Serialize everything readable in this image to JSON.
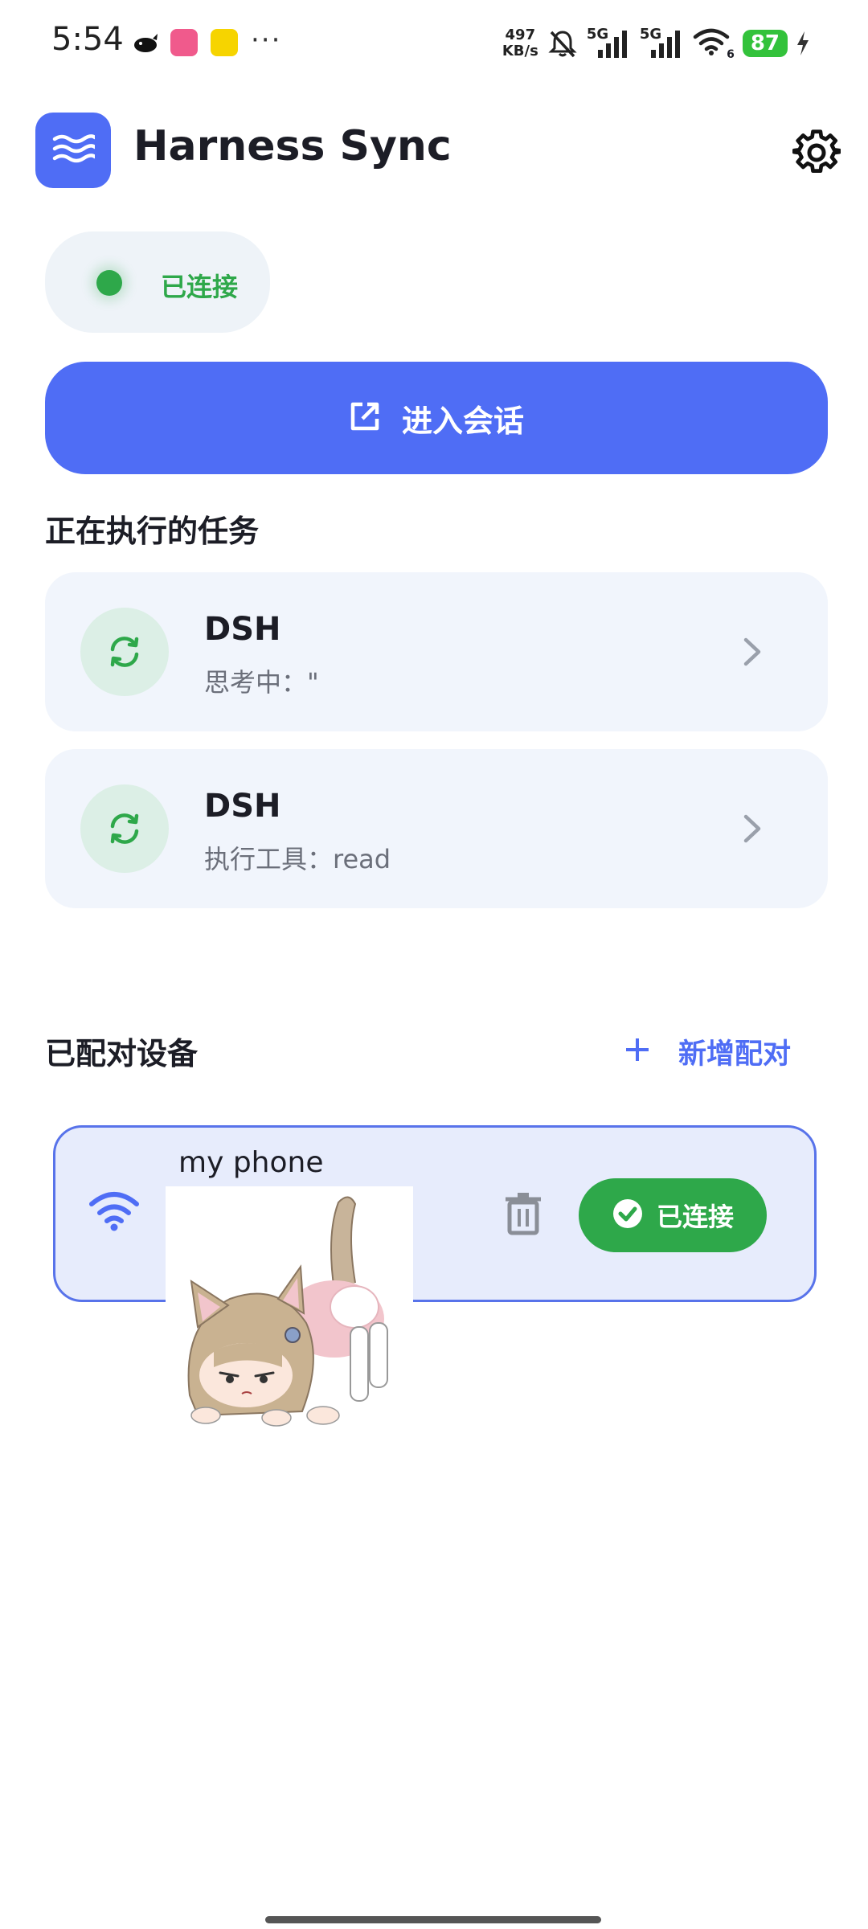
{
  "status_bar": {
    "time": "5:54",
    "net_speed_value": "497",
    "net_speed_unit": "KB/s",
    "signal1_label": "5G",
    "signal2_label": "5G",
    "wifi_badge": "6",
    "battery": "87",
    "icons": [
      "whale-app-icon",
      "bilibili-app-icon",
      "emoji-app-icon",
      "mute-bell-icon",
      "signal-icon",
      "wifi-icon",
      "charging-icon"
    ]
  },
  "header": {
    "title": "Harness Sync",
    "logo_icon": "waves-icon",
    "settings_icon": "gear-icon",
    "brand_color": "#4f6df5"
  },
  "connection": {
    "label": "已连接",
    "color": "#2ea84a"
  },
  "primary_action": {
    "label": "进入会话",
    "icon": "open-external-icon"
  },
  "tasks": {
    "title": "正在执行的任务",
    "items": [
      {
        "name": "DSH",
        "status": "思考中：\"",
        "icon": "sync-icon"
      },
      {
        "name": "DSH",
        "status": "执行工具：read",
        "icon": "sync-icon"
      }
    ]
  },
  "devices": {
    "title": "已配对设备",
    "add_label": "新增配对",
    "items": [
      {
        "name": "my phone",
        "status_label": "已连接",
        "icon": "wifi-icon"
      }
    ]
  }
}
